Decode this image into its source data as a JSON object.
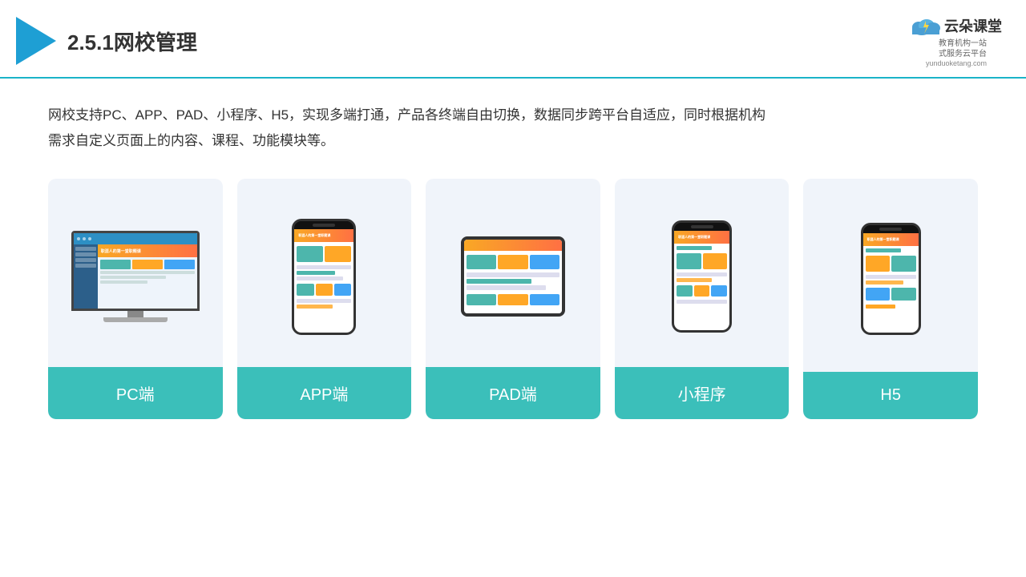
{
  "header": {
    "title": "2.5.1网校管理",
    "brand": {
      "name": "云朵课堂",
      "url": "yunduoketang.com",
      "tagline": "教育机构一站\n式服务云平台"
    }
  },
  "description": "网校支持PC、APP、PAD、小程序、H5，实现多端打通，产品各终端自由切换，数据同步跨平台自适应，同时根据机构\n需求自定义页面上的内容、课程、功能模块等。",
  "cards": [
    {
      "id": "pc",
      "label": "PC端"
    },
    {
      "id": "app",
      "label": "APP端"
    },
    {
      "id": "pad",
      "label": "PAD端"
    },
    {
      "id": "miniprogram",
      "label": "小程序"
    },
    {
      "id": "h5",
      "label": "H5"
    }
  ],
  "colors": {
    "accent": "#3bbfba",
    "header_line": "#1ab3c8",
    "triangle": "#1e9fd4"
  }
}
